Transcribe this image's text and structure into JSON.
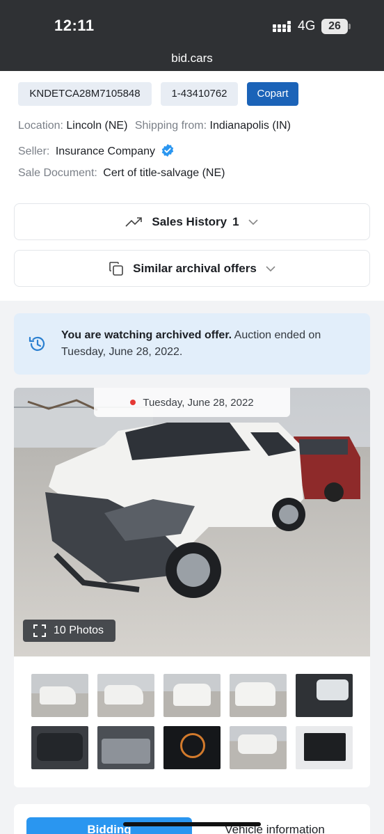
{
  "status_bar": {
    "time": "12:11",
    "network": "4G",
    "battery": "26",
    "url": "bid.cars"
  },
  "lot": {
    "vin": "KNDETCA28M7105848",
    "lot_number": "1-43410762",
    "auction": "Copart",
    "location_label": "Location:",
    "location_value": "Lincoln (NE)",
    "shipping_label": "Shipping from:",
    "shipping_value": "Indianapolis (IN)",
    "seller_label": "Seller:",
    "seller_value": "Insurance Company",
    "sale_doc_label": "Sale Document:",
    "sale_doc_value": "Cert of title-salvage (NE)"
  },
  "accordions": {
    "sales_history_label": "Sales History",
    "sales_history_count": "1",
    "similar_label": "Similar archival offers"
  },
  "notice": {
    "bold": "You are watching archived offer.",
    "rest": " Auction ended on Tuesday, June 28, 2022."
  },
  "gallery": {
    "date": "Tuesday, June 28, 2022",
    "photos_label": "10 Photos"
  },
  "tabs": {
    "bidding": "Bidding",
    "vehicle_info": "Vehicle information"
  },
  "colors": {
    "accent": "#1b63b8",
    "tab_active": "#2a96f0",
    "notice_bg": "#e2eefa",
    "verified": "#2a96f0"
  }
}
